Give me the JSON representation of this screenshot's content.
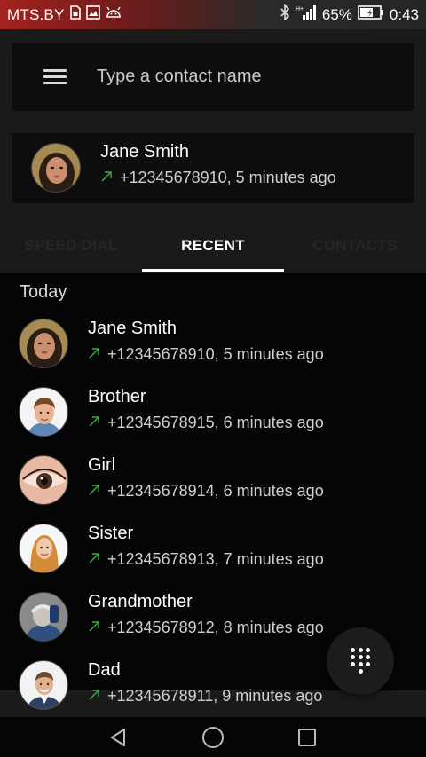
{
  "status_bar": {
    "carrier": "MTS.BY",
    "battery_percent": "65%",
    "time": "0:43",
    "icons": [
      "sim-icon",
      "image-icon",
      "android-icon",
      "bluetooth-icon",
      "signal-icon",
      "battery-icon"
    ]
  },
  "search": {
    "placeholder": "Type a contact name"
  },
  "last_call": {
    "name": "Jane Smith",
    "detail": "+12345678910, 5 minutes ago"
  },
  "tabs": [
    {
      "label": "SPEED DIAL",
      "active": false
    },
    {
      "label": "RECENT",
      "active": true
    },
    {
      "label": "CONTACTS",
      "active": false
    }
  ],
  "recent": {
    "section_label": "Today",
    "items": [
      {
        "name": "Jane Smith",
        "detail": "+12345678910, 5 minutes ago"
      },
      {
        "name": "Brother",
        "detail": "+12345678915, 6 minutes ago"
      },
      {
        "name": "Girl",
        "detail": "+12345678914, 6 minutes ago"
      },
      {
        "name": "Sister",
        "detail": "+12345678913, 7 minutes ago"
      },
      {
        "name": "Grandmother",
        "detail": "+12345678912, 8 minutes ago"
      },
      {
        "name": "Dad",
        "detail": "+12345678911, 9 minutes ago"
      }
    ]
  },
  "colors": {
    "accent_call": "#3fae4a",
    "status_bar_red": "#a3221f"
  }
}
